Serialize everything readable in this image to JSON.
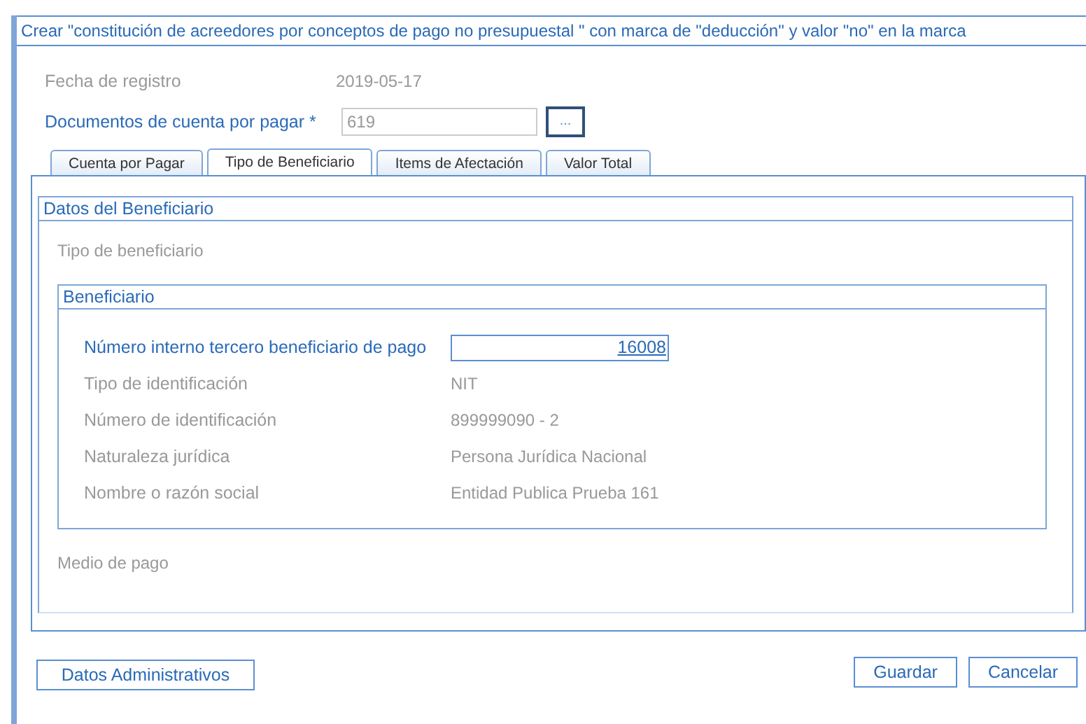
{
  "window": {
    "title": "Crear \"constitución de acreedores por conceptos de pago no presupuestal \" con marca de \"deducción\" y valor \"no\" en la marca"
  },
  "header_fields": [
    {
      "kind": "static",
      "label": "Fecha de registro",
      "value": "2019-05-17"
    },
    {
      "kind": "lookup",
      "label": "Documentos de cuenta por pagar *",
      "value": "619",
      "button": "..."
    }
  ],
  "tabs": [
    {
      "label": "Cuenta por Pagar",
      "selected": false
    },
    {
      "label": "Tipo de Beneficiario",
      "selected": true
    },
    {
      "label": "Items de Afectación",
      "selected": false
    },
    {
      "label": "Valor Total",
      "selected": false
    }
  ],
  "beneficiary_data": {
    "title": "Datos del Beneficiario",
    "type_label": "Tipo de beneficiario",
    "beneficiary": {
      "title": "Beneficiario",
      "rows": [
        {
          "kind": "input",
          "label": "Número interno tercero beneficiario de pago",
          "value": "16008"
        },
        {
          "kind": "static",
          "label": "Tipo de identificación",
          "value": "NIT"
        },
        {
          "kind": "static",
          "label": "Número de identificación",
          "value": "899999090 - 2"
        },
        {
          "kind": "static",
          "label": "Naturaleza jurídica",
          "value": "Persona Jurídica Nacional"
        },
        {
          "kind": "static",
          "label": "Nombre o razón social",
          "value": "Entidad Publica Prueba 161"
        }
      ]
    },
    "payment_label": "Medio de pago"
  },
  "buttons_left": [
    "Datos Administrativos"
  ],
  "buttons_right": [
    "Guardar",
    "Cancelar"
  ]
}
